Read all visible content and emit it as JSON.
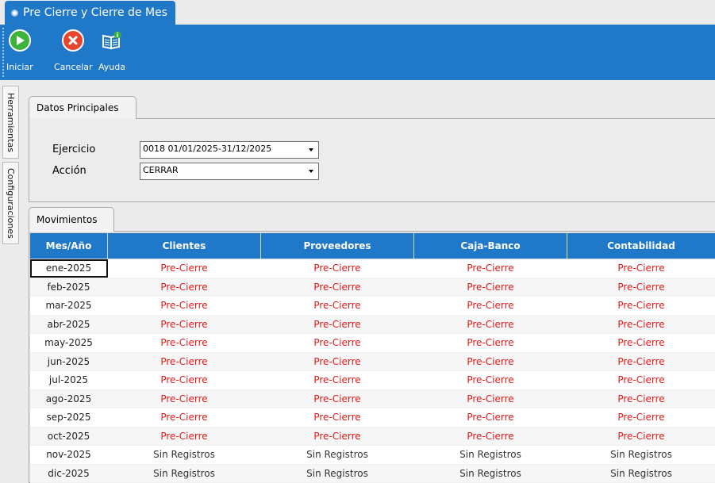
{
  "window": {
    "title": "Pre Cierre y Cierre de Mes"
  },
  "toolbar": {
    "iniciar_label": "Iniciar",
    "cancelar_label": "Cancelar",
    "ayuda_label": "Ayuda"
  },
  "side_tabs": {
    "herramientas": "Herramientas",
    "configuraciones": "Configuraciones"
  },
  "datos": {
    "tab_label": "Datos Principales",
    "ejercicio_label": "Ejercicio",
    "ejercicio_value": "0018 01/01/2025-31/12/2025",
    "accion_label": "Acción",
    "accion_value": "CERRAR"
  },
  "movimientos": {
    "tab_label": "Movimientos",
    "columns": [
      "Mes/Año",
      "Clientes",
      "Proveedores",
      "Caja-Banco",
      "Contabilidad"
    ],
    "rows": [
      [
        "ene-2025",
        "Pre-Cierre",
        "Pre-Cierre",
        "Pre-Cierre",
        "Pre-Cierre"
      ],
      [
        "feb-2025",
        "Pre-Cierre",
        "Pre-Cierre",
        "Pre-Cierre",
        "Pre-Cierre"
      ],
      [
        "mar-2025",
        "Pre-Cierre",
        "Pre-Cierre",
        "Pre-Cierre",
        "Pre-Cierre"
      ],
      [
        "abr-2025",
        "Pre-Cierre",
        "Pre-Cierre",
        "Pre-Cierre",
        "Pre-Cierre"
      ],
      [
        "may-2025",
        "Pre-Cierre",
        "Pre-Cierre",
        "Pre-Cierre",
        "Pre-Cierre"
      ],
      [
        "jun-2025",
        "Pre-Cierre",
        "Pre-Cierre",
        "Pre-Cierre",
        "Pre-Cierre"
      ],
      [
        "jul-2025",
        "Pre-Cierre",
        "Pre-Cierre",
        "Pre-Cierre",
        "Pre-Cierre"
      ],
      [
        "ago-2025",
        "Pre-Cierre",
        "Pre-Cierre",
        "Pre-Cierre",
        "Pre-Cierre"
      ],
      [
        "sep-2025",
        "Pre-Cierre",
        "Pre-Cierre",
        "Pre-Cierre",
        "Pre-Cierre"
      ],
      [
        "oct-2025",
        "Pre-Cierre",
        "Pre-Cierre",
        "Pre-Cierre",
        "Pre-Cierre"
      ],
      [
        "nov-2025",
        "Sin Registros",
        "Sin Registros",
        "Sin Registros",
        "Sin Registros"
      ],
      [
        "dic-2025",
        "Sin Registros",
        "Sin Registros",
        "Sin Registros",
        "Sin Registros"
      ]
    ]
  },
  "colors": {
    "accent": "#1f78c8",
    "pre_cierre": "#e11a1a",
    "panel_bg": "#ebebeb"
  },
  "icons": {
    "iniciar": "play-circle-icon",
    "cancelar": "cancel-circle-icon",
    "ayuda": "book-info-icon",
    "title": "window-dot-icon"
  }
}
